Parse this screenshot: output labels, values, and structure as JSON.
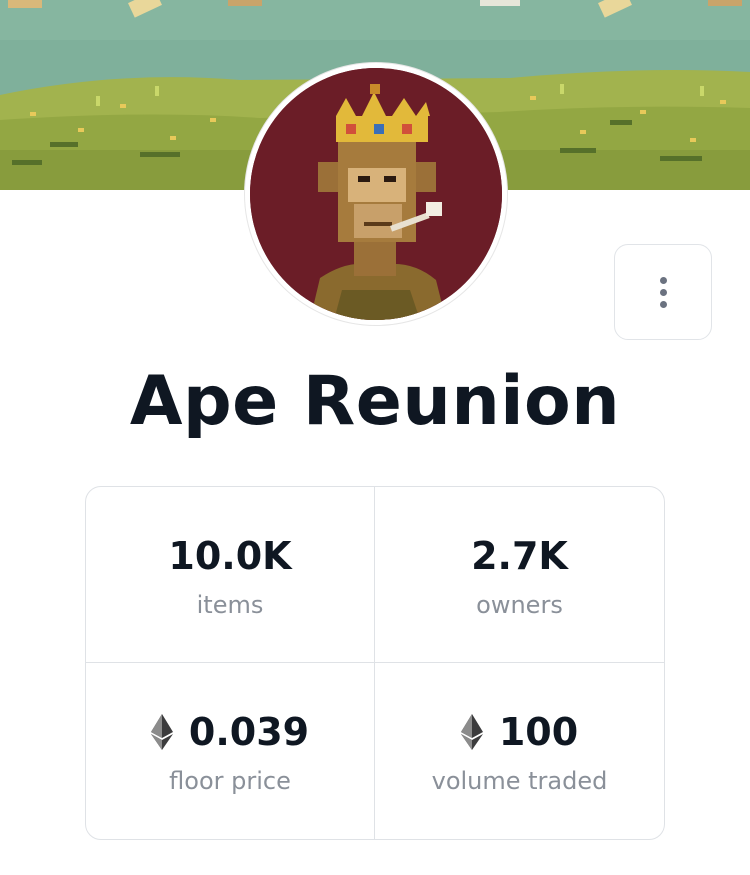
{
  "collection": {
    "name": "Ape Reunion"
  },
  "actions": {
    "more_icon": "kebab-vertical-icon"
  },
  "stats": [
    {
      "value": "10.0K",
      "label": "items",
      "icon": null
    },
    {
      "value": "2.7K",
      "label": "owners",
      "icon": null
    },
    {
      "value": "0.039",
      "label": "floor price",
      "icon": "ethereum-icon"
    },
    {
      "value": "100",
      "label": "volume traded",
      "icon": "ethereum-icon"
    }
  ],
  "colors": {
    "banner_sky": "#7fb09b",
    "banner_grass": "#9fb14e",
    "avatar_bg": "#6b1d27",
    "title": "#0f1722",
    "label": "#8a9099",
    "border": "#dfe2e6"
  }
}
